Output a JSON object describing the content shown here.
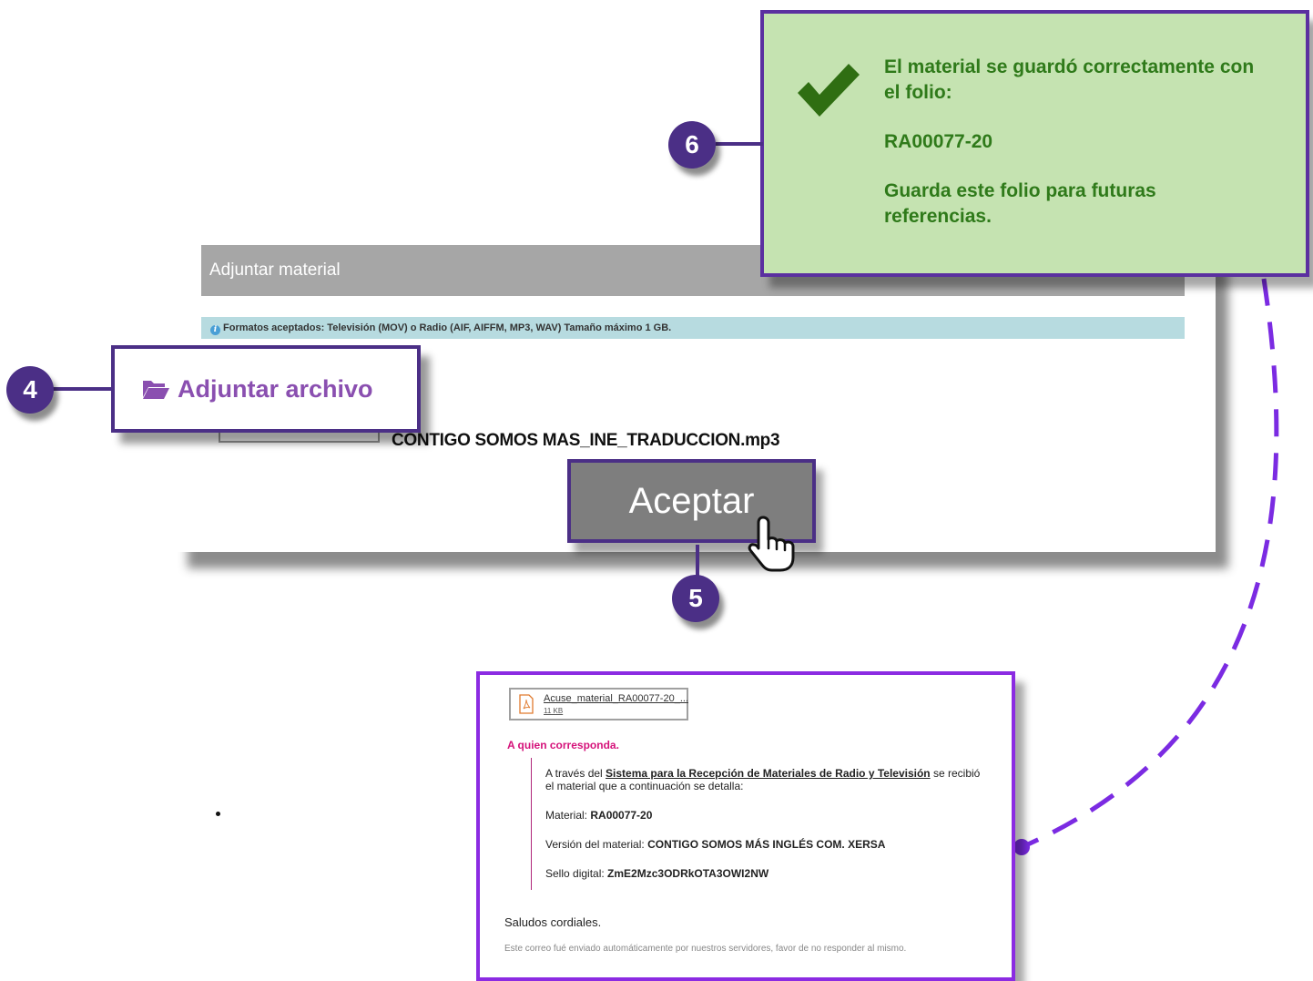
{
  "panel": {
    "header_title": "Adjuntar material",
    "info_text": "Formatos aceptados: Televisión (MOV) o Radio (AIF, AIFFM, MP3, WAV) Tamaño máximo 1 GB.",
    "attach_button_label": "Adjuntar archivo",
    "selected_file": "CONTIGO SOMOS MAS_INE_TRADUCCION.mp3",
    "accept_button_label": "Aceptar"
  },
  "callouts": {
    "step_4": "4",
    "step_5": "5",
    "step_6": "6"
  },
  "success": {
    "line1": "El material se guardó correctamente con el folio:",
    "folio": "RA00077-20",
    "line3": "Guarda este folio para futuras referencias."
  },
  "email": {
    "attachment_name": "Acuse_material_RA00077-20_...",
    "attachment_size": "11 KB",
    "greeting": "A quien corresponda.",
    "intro_prefix": "A través del ",
    "system_name": "Sistema para la Recepción de Materiales de Radio y Televisión",
    "intro_suffix": " se recibió el material que a continuación se detalla:",
    "material_label": "Material: ",
    "material_value": "RA00077-20",
    "version_label": "Versión del material: ",
    "version_value": "CONTIGO SOMOS MÁS INGLÉS COM. XERSA",
    "seal_label": "Sello digital: ",
    "seal_value": "ZmE2Mzc3ODRkOTA3OWI2NW",
    "regards": "Saludos cordiales.",
    "auto_note": "Este correo fué enviado automáticamente por nuestros servidores, favor de no responder al mismo."
  },
  "colors": {
    "accent_purple": "#4b2f86",
    "success_bg": "#c5e3b1",
    "success_text": "#2f7a1a",
    "email_border": "#8b2be2",
    "greeting_pink": "#d5127a"
  },
  "icons": [
    "info-icon",
    "folder-open-icon",
    "hand-pointer-icon",
    "checkmark-icon",
    "pdf-file-icon"
  ]
}
